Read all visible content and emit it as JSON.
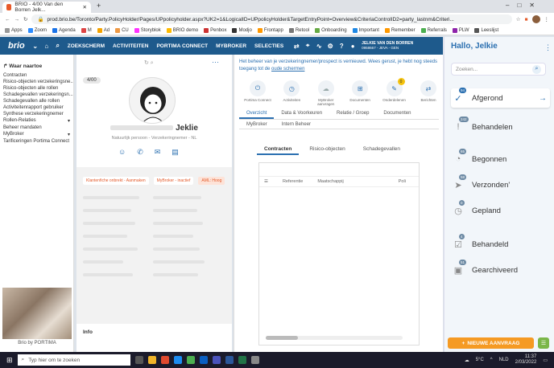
{
  "browser": {
    "tab_title": "BRIO - 4/00 Van den Borren Jelk...",
    "url": "prod.brio.be/Toronto/Party.PolicyHolder/Pages/UPpolicyholder.aspx?UK2=1&LogicalID=UPpolicyHolder&TargetEntryPoint=Overview&CriteriaControlID2=party_lastnm&Criteri...",
    "bookmarks": [
      "Apps",
      "Zoom",
      "Agenda",
      "M",
      "Ad",
      "CU",
      "Storyblok",
      "BRIO demo",
      "Penbox",
      "Modjo",
      "Frontapp",
      "Retool",
      "Onboarding",
      "Important",
      "Remember",
      "Referrals",
      "PLW",
      "Leeslijst"
    ]
  },
  "appnav": {
    "logo": "brio",
    "items": [
      "ZOEKSCHERM",
      "ACTIVITEITEN",
      "PORTIMA CONNECT",
      "MYBROKER",
      "SELECTIES"
    ],
    "user_name": "JELKIE VAN DEN BORREN",
    "user_sub": "0958667 - JEVA - GEN"
  },
  "leftnav": {
    "title": "Waar naartoe",
    "items": [
      "Contracten",
      "Risico-objecten verzekeringsne...",
      "Risico-objecten alle rollen",
      "Schadegevallen verzekeringsn...",
      "Schadegevallen alle rollen",
      "Activiteitenrapport gebruiker",
      "Synthese verzekeringnemer",
      "Rollen-Relaties",
      "Beheer mandaten",
      "MyBroker",
      "Tarificeringen Portima Connect"
    ],
    "footer": "Brio by PORTIMA"
  },
  "profile": {
    "badge": "4/00",
    "name": "Jeklie",
    "subtitle": "Natuurlijk persoon - Verzekeringnemer - NL",
    "tags": [
      "Klantenfiche onbrekt - Aanmaken",
      "MyBroker - inactief",
      "AML: Hoog"
    ],
    "info": "Info"
  },
  "content": {
    "notice": "Het beheer van je verzekeringnemer/prospect is vernieuwd. Wees gerust, je hebt nog steeds toegang tot de ",
    "notice_link": "oude schermen",
    "quick_actions": [
      {
        "label": "Portima Connect",
        "icon": "plug-icon"
      },
      {
        "label": "Activiteiten",
        "icon": "clock-icon"
      },
      {
        "label": "MyBroker aanvragen",
        "icon": "chat-icon"
      },
      {
        "label": "Documenten",
        "icon": "tree-icon"
      },
      {
        "label": "Onderdelenen",
        "icon": "pen-icon",
        "count": "0"
      },
      {
        "label": "Berichten",
        "icon": "swap-icon"
      }
    ],
    "tabs1": [
      "Overzicht",
      "Data & Voorkeuren",
      "Relatie / Groep",
      "Documenten"
    ],
    "tabs2": [
      "MyBroker",
      "Intern Beheer"
    ],
    "tabs3": [
      "Contracten",
      "Risico-objecten",
      "Schadegevallen"
    ],
    "columns": [
      "Referentie",
      "Maatschappij",
      "Poli"
    ]
  },
  "rightpanel": {
    "greeting": "Hallo, Jelkie",
    "search_placeholder": "Zoeken...",
    "statuses": [
      {
        "label": "Afgerond",
        "count": "94",
        "icon": "check-circle-icon",
        "active": true
      },
      {
        "label": "Behandelen",
        "count": "242",
        "icon": "alert-icon"
      },
      {
        "label": "Begonnen",
        "count": "65",
        "icon": "progress-icon"
      },
      {
        "label": "Verzonden'",
        "count": "58",
        "icon": "send-icon"
      },
      {
        "label": "Gepland",
        "count": "0",
        "icon": "calendar-clock-icon"
      },
      {
        "label": "Behandeld",
        "count": "4",
        "icon": "clipboard-check-icon"
      },
      {
        "label": "Gearchiveerd",
        "count": "51",
        "icon": "archive-icon"
      }
    ],
    "new_request": "NIEUWE AANVRAAG"
  },
  "taskbar": {
    "search": "Typ hier om te zoeken",
    "weather": "5°C",
    "lang": "NLD",
    "time": "11:37",
    "date": "2/03/2022"
  }
}
